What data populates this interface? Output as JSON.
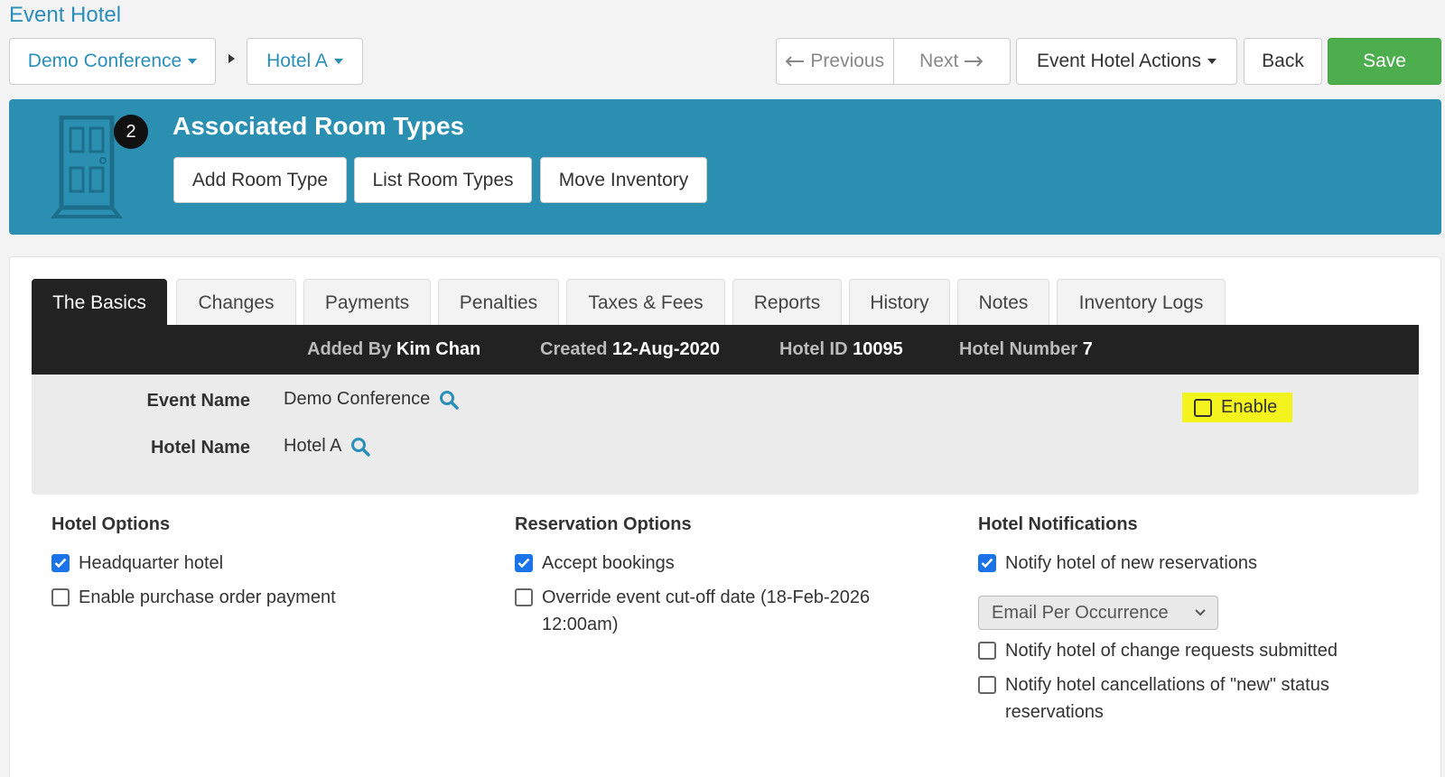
{
  "page_title": "Event Hotel",
  "nav": {
    "event_select": "Demo Conference",
    "hotel_select": "Hotel A",
    "previous": "Previous",
    "next": "Next",
    "actions": "Event Hotel Actions",
    "back": "Back",
    "save": "Save"
  },
  "banner": {
    "badge_count": "2",
    "title": "Associated Room Types",
    "buttons": [
      "Add Room Type",
      "List Room Types",
      "Move Inventory"
    ]
  },
  "tabs": [
    "The Basics",
    "Changes",
    "Payments",
    "Penalties",
    "Taxes & Fees",
    "Reports",
    "History",
    "Notes",
    "Inventory Logs"
  ],
  "active_tab": "The Basics",
  "info": {
    "added_by_label": "Added By",
    "added_by_value": "Kim Chan",
    "created_label": "Created",
    "created_value": "12-Aug-2020",
    "hotel_id_label": "Hotel ID",
    "hotel_id_value": "10095",
    "hotel_number_label": "Hotel Number",
    "hotel_number_value": "7"
  },
  "fields": {
    "event_name_label": "Event Name",
    "event_name_value": "Demo Conference",
    "hotel_name_label": "Hotel Name",
    "hotel_name_value": "Hotel A",
    "enable_label": "Enable"
  },
  "hotel_options": {
    "title": "Hotel Options",
    "items": [
      {
        "label": "Headquarter hotel",
        "checked": true
      },
      {
        "label": "Enable purchase order payment",
        "checked": false
      }
    ]
  },
  "reservation_options": {
    "title": "Reservation Options",
    "items": [
      {
        "label": "Accept bookings",
        "checked": true
      },
      {
        "label": "Override event cut-off date (18-Feb-2026 12:00am)",
        "checked": false
      }
    ]
  },
  "hotel_notifications": {
    "title": "Hotel Notifications",
    "items": [
      {
        "label": "Notify hotel of new reservations",
        "checked": true
      },
      {
        "label": "Notify hotel of change requests submitted",
        "checked": false
      },
      {
        "label": "Notify hotel cancellations of \"new\" status reservations",
        "checked": false
      }
    ],
    "frequency_select": "Email Per Occurrence"
  },
  "colors": {
    "accent": "#2a8fb8",
    "banner": "#2b8fb2",
    "save": "#4cae4c",
    "highlight": "#f4f31e",
    "checkbox": "#1a73e8"
  }
}
